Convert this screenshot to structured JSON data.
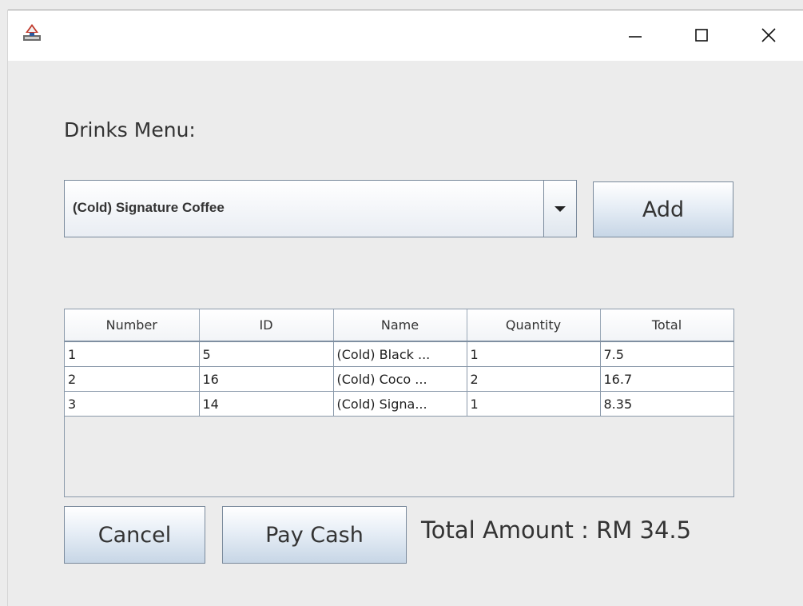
{
  "window": {
    "minimize_glyph": "—",
    "maximize_glyph": "☐",
    "close_glyph": "✕"
  },
  "heading": "Drinks Menu:",
  "drink_select": {
    "selected": "(Cold) Signature Coffee"
  },
  "buttons": {
    "add": "Add",
    "cancel": "Cancel",
    "pay_cash": "Pay Cash"
  },
  "table": {
    "columns": [
      "Number",
      "ID",
      "Name",
      "Quantity",
      "Total"
    ],
    "rows": [
      [
        "1",
        "5",
        "(Cold) Black ...",
        "1",
        "7.5"
      ],
      [
        "2",
        "16",
        "(Cold) Coco ...",
        "2",
        "16.7"
      ],
      [
        "3",
        "14",
        "(Cold) Signa...",
        "1",
        "8.35"
      ]
    ]
  },
  "total_amount": "Total Amount : RM 34.5"
}
